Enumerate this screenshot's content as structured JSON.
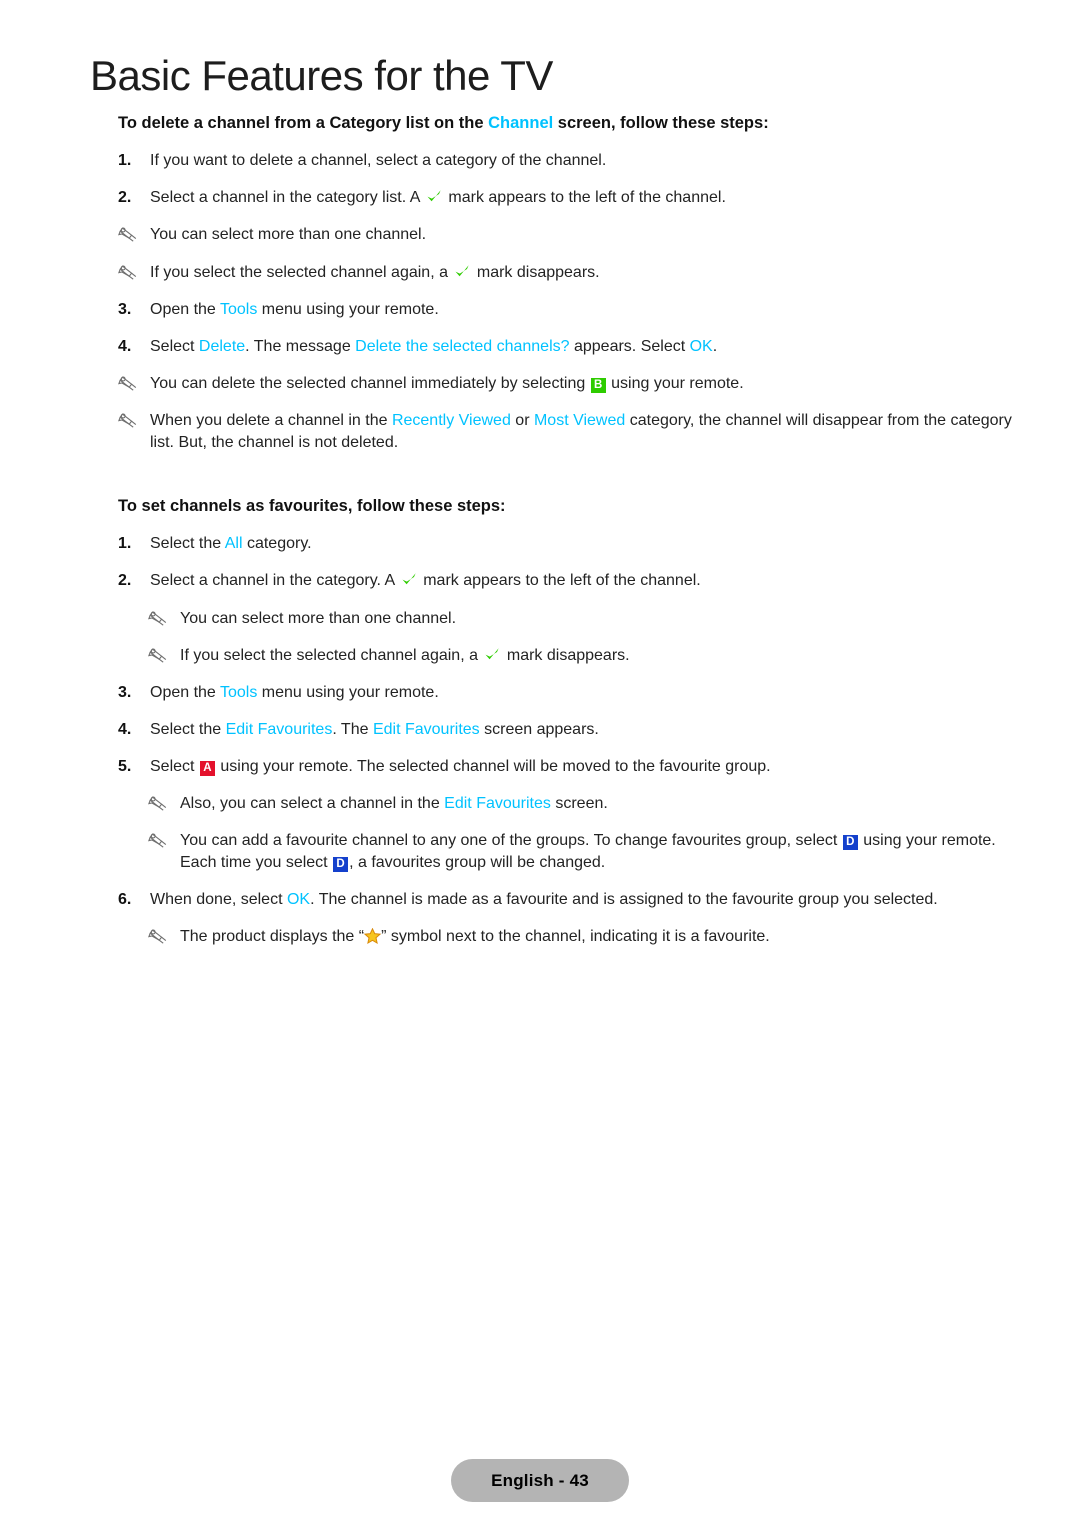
{
  "page": {
    "title": "Basic Features for the TV",
    "footer_label": "English - 43"
  },
  "colors": {
    "accent_cyan": "#00c2ff",
    "check_green": "#2ecc00",
    "key_a_red": "#e4112c",
    "key_b_green": "#2ecc00",
    "key_d_blue": "#1440cc",
    "star_gold": "#f5c518",
    "footer_pill_gray": "#b4b4b4",
    "text_black": "#232323"
  },
  "sections": [
    {
      "id": "delete-channel",
      "heading_parts": [
        {
          "t": "To delete a channel from a Category list on the "
        },
        {
          "t": "Channel",
          "cyan": true
        },
        {
          "t": " screen, follow these steps:"
        }
      ],
      "heading_plain": "To delete a channel from a Category list on the Channel screen, follow these steps:",
      "items": [
        {
          "kind": "step",
          "num": "1.",
          "text": "If you want to delete a channel, select a category of the channel."
        },
        {
          "kind": "step",
          "num": "2.",
          "text": "Select a channel in the category list. A ✓ mark appears to the left of the channel."
        },
        {
          "kind": "note",
          "indent": false,
          "text": "You can select more than one channel."
        },
        {
          "kind": "note",
          "indent": false,
          "text": "If you select the selected channel again, a ✓ mark disappears."
        },
        {
          "kind": "step",
          "num": "3.",
          "text": "Open the Tools menu using your remote."
        },
        {
          "kind": "step",
          "num": "4.",
          "text": "Select Delete. The message Delete the selected channels? appears. Select OK."
        },
        {
          "kind": "note",
          "indent": false,
          "text": "You can delete the selected channel immediately by selecting B using your remote."
        },
        {
          "kind": "note",
          "indent": false,
          "text": "When you delete a channel in the Recently Viewed or Most Viewed category, the channel will disappear from the category list. But, the channel is not deleted."
        }
      ]
    },
    {
      "id": "set-favourites",
      "heading_parts": [
        {
          "t": "To set channels as favourites, follow these steps:"
        }
      ],
      "heading_plain": "To set channels as favourites, follow these steps:",
      "items": [
        {
          "kind": "step",
          "num": "1.",
          "text": "Select the All category."
        },
        {
          "kind": "step",
          "num": "2.",
          "text": "Select a channel in the category. A ✓ mark appears to the left of the channel."
        },
        {
          "kind": "note",
          "indent": true,
          "text": "You can select more than one channel."
        },
        {
          "kind": "note",
          "indent": true,
          "text": "If you select the selected channel again, a ✓ mark disappears."
        },
        {
          "kind": "step",
          "num": "3.",
          "text": "Open the Tools menu using your remote."
        },
        {
          "kind": "step",
          "num": "4.",
          "text": "Select the Edit Favourites. The Edit Favourites screen appears."
        },
        {
          "kind": "step",
          "num": "5.",
          "text": "Select A using your remote. The selected channel will be moved to the favourite group."
        },
        {
          "kind": "note",
          "indent": true,
          "text": "Also, you can select a channel in the Edit Favourites screen."
        },
        {
          "kind": "note",
          "indent": true,
          "text": "You can add a favourite channel to any one of the groups. To change favourites group, select D using your remote. Each time you select D, a favourites group will be changed."
        },
        {
          "kind": "step",
          "num": "6.",
          "text": "When done, select OK. The channel is made as a favourite and is assigned to the favourite group you selected."
        },
        {
          "kind": "note",
          "indent": true,
          "text": "The product displays the “★” symbol next to the channel, indicating it is a favourite."
        }
      ]
    }
  ],
  "text": {
    "s1_h_a": "To delete a channel from a Category list on the ",
    "s1_h_link": "Channel",
    "s1_h_b": " screen, follow these steps:",
    "s1_1_num": "1.",
    "s1_1": "If you want to delete a channel, select a category of the channel.",
    "s1_2_num": "2.",
    "s1_2_a": "Select a channel in the category list. A ",
    "s1_2_b": " mark appears to the left of the channel.",
    "s1_n1": "You can select more than one channel.",
    "s1_n2_a": "If you select the selected channel again, a ",
    "s1_n2_b": " mark disappears.",
    "s1_3_num": "3.",
    "s1_3_a": "Open the ",
    "s1_3_link": "Tools",
    "s1_3_b": " menu using your remote.",
    "s1_4_num": "4.",
    "s1_4_a": "Select ",
    "s1_4_link1": "Delete",
    "s1_4_b": ". The message ",
    "s1_4_link2": "Delete the selected channels?",
    "s1_4_c": " appears. Select ",
    "s1_4_link3": "OK",
    "s1_4_d": ".",
    "s1_n3_a": "You can delete the selected channel immediately by selecting ",
    "s1_n3_key": "B",
    "s1_n3_b": " using your remote.",
    "s1_n4_a": "When you delete a channel in the ",
    "s1_n4_link1": "Recently Viewed",
    "s1_n4_b": " or ",
    "s1_n4_link2": "Most Viewed",
    "s1_n4_c": " category, the channel will disappear from the category list. But, the channel is not deleted.",
    "s2_h": "To set channels as favourites, follow these steps:",
    "s2_1_num": "1.",
    "s2_1_a": "Select the ",
    "s2_1_link": "All",
    "s2_1_b": " category.",
    "s2_2_num": "2.",
    "s2_2_a": "Select a channel in the category. A ",
    "s2_2_b": " mark appears to the left of the channel.",
    "s2_n1": "You can select more than one channel.",
    "s2_n2_a": "If you select the selected channel again, a ",
    "s2_n2_b": " mark disappears.",
    "s2_3_num": "3.",
    "s2_3_a": "Open the ",
    "s2_3_link": "Tools",
    "s2_3_b": " menu using your remote.",
    "s2_4_num": "4.",
    "s2_4_a": "Select the ",
    "s2_4_link1": "Edit Favourites",
    "s2_4_b": ". The ",
    "s2_4_link2": "Edit Favourites",
    "s2_4_c": " screen appears.",
    "s2_5_num": "5.",
    "s2_5_a": "Select ",
    "s2_5_key": "A",
    "s2_5_b": " using your remote. The selected channel will be moved to the favourite group.",
    "s2_n3_a": "Also, you can select a channel in the ",
    "s2_n3_link": "Edit Favourites",
    "s2_n3_b": " screen.",
    "s2_n4_a": "You can add a favourite channel to any one of the groups. To change favourites group, select ",
    "s2_n4_key1": "D",
    "s2_n4_b": " using your remote. Each time you select ",
    "s2_n4_key2": "D",
    "s2_n4_c": ", a favourites group will be changed.",
    "s2_6_num": "6.",
    "s2_6_a": "When done, select ",
    "s2_6_link": "OK",
    "s2_6_b": ". The channel is made as a favourite and is assigned to the favourite group you selected.",
    "s2_n5_a": "The product displays the “",
    "s2_n5_b": "” symbol next to the channel, indicating it is a favourite."
  }
}
